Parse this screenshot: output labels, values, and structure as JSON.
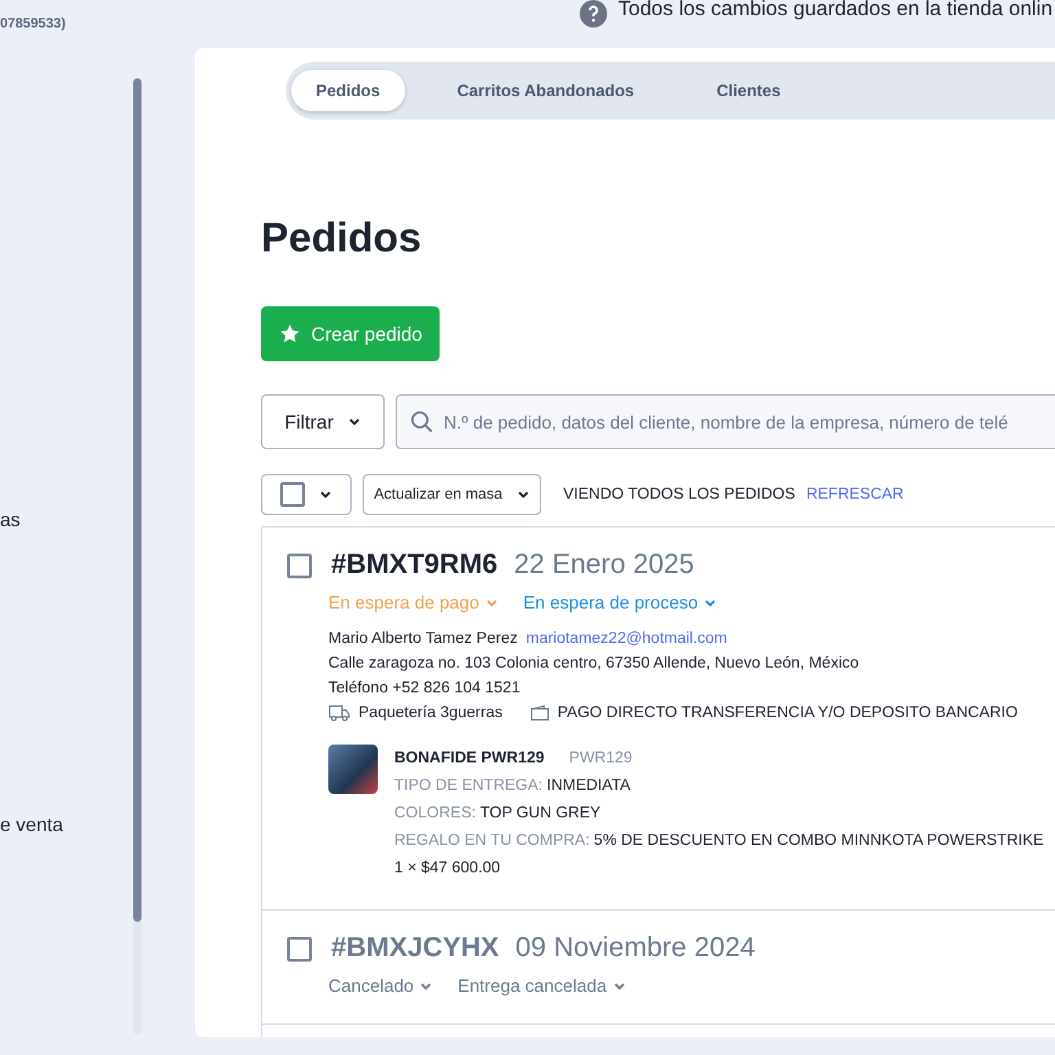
{
  "sidebar": {
    "account_id": "07859533)",
    "items": [
      "as",
      "e venta"
    ]
  },
  "save_notice": "Todos los cambios guardados en la tienda onlin",
  "tabs": [
    {
      "label": "Pedidos",
      "selected": true
    },
    {
      "label": "Carritos Abandonados",
      "selected": false
    },
    {
      "label": "Clientes",
      "selected": false
    }
  ],
  "title": "Pedidos",
  "create_button": "Crear pedido",
  "filter_button": "Filtrar",
  "search": {
    "placeholder": "N.º de pedido, datos del cliente, nombre de la empresa, número de telé"
  },
  "bulk": {
    "select_all_checked": false,
    "bulk_update": "Actualizar en masa",
    "viewing": "VIENDO TODOS LOS PEDIDOS",
    "refresh": "REFRESCAR"
  },
  "orders": [
    {
      "id": "#BMXT9RM6",
      "date": "22 Enero 2025",
      "checked": false,
      "cancelled": false,
      "payment_status": {
        "label": "En espera de pago",
        "color": "#f5a04a"
      },
      "fulfillment_status": {
        "label": "En espera de proceso",
        "color": "#1e8fe0"
      },
      "customer": "Mario Alberto Tamez Perez",
      "email": "mariotamez22@hotmail.com",
      "address": "Calle zaragoza no. 103 Colonia centro, 67350 Allende, Nuevo León, México",
      "phone": "Teléfono +52 826 104 1521",
      "shipping": "Paquetería 3guerras",
      "payment": "PAGO DIRECTO TRANSFERENCIA Y/O DEPOSITO BANCARIO",
      "items": [
        {
          "name": "BONAFIDE PWR129",
          "sku": "PWR129",
          "options": [
            {
              "label": "TIPO DE ENTREGA:",
              "value": "INMEDIATA"
            },
            {
              "label": "COLORES:",
              "value": "TOP GUN GREY"
            },
            {
              "label": "REGALO EN TU COMPRA:",
              "value": "5% DE DESCUENTO EN COMBO MINNKOTA POWERSTRIKE"
            }
          ],
          "price": "1 × $47 600.00"
        }
      ]
    },
    {
      "id": "#BMXJCYHX",
      "date": "09 Noviembre 2024",
      "checked": false,
      "cancelled": true,
      "payment_status": {
        "label": "Cancelado",
        "color": "#6b7a90"
      },
      "fulfillment_status": {
        "label": "Entrega cancelada",
        "color": "#6b7a90"
      }
    }
  ]
}
